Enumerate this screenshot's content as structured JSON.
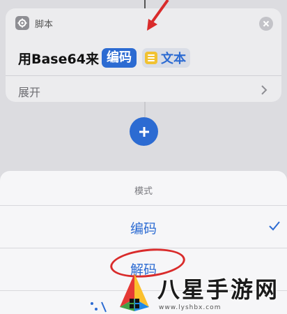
{
  "card": {
    "category_label": "脚本",
    "action_prefix": "用Base64来",
    "mode_token": "编码",
    "variable_token": "文本",
    "expand_label": "展开"
  },
  "sheet": {
    "title": "模式",
    "options": [
      {
        "label": "编码",
        "selected": true
      },
      {
        "label": "解码",
        "selected": false
      }
    ]
  },
  "watermark": {
    "brand_text": "八星手游网",
    "url": "www.lyshbx.com"
  },
  "colors": {
    "accent": "#2c6bd2",
    "annotation": "#d92b2b",
    "variable_icon": "#f1c232"
  }
}
